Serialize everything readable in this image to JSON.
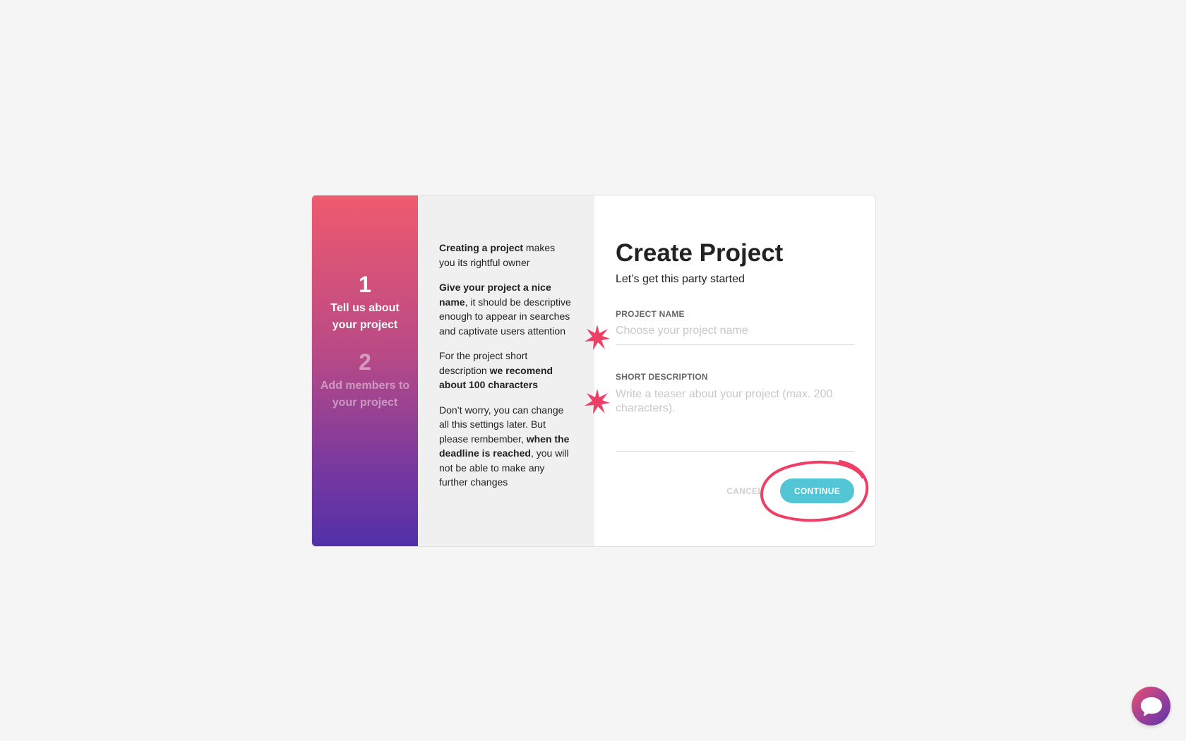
{
  "steps": [
    {
      "number": "1",
      "label": "Tell us about your project"
    },
    {
      "number": "2",
      "label": "Add members to your project"
    }
  ],
  "help": {
    "p1_bold": "Creating a project",
    "p1_rest": " makes you its rightful owner",
    "p2_bold": "Give your project a nice name",
    "p2_rest": ", it should be descriptive enough to appear in searches and captivate users attention",
    "p3_start": "For the project short description ",
    "p3_bold": "we recomend about 100 characters",
    "p4_start": "Don’t worry, you can change all this settings later. But please rembember, ",
    "p4_bold": "when the deadline is reached",
    "p4_rest": ", you will not be able to make any further changes"
  },
  "form": {
    "title": "Create Project",
    "subtitle": "Let’s get this party started",
    "project_name_label": "PROJECT NAME",
    "project_name_placeholder": "Choose your project name",
    "project_name_value": "",
    "short_description_label": "SHORT DESCRIPTION",
    "short_description_placeholder": "Write a teaser about your project (max. 200 characters).",
    "short_description_value": "",
    "cancel_label": "CANCEL",
    "continue_label": "CONTINUE"
  },
  "colors": {
    "accent": "#52c6d4",
    "annotation": "#ee3f66",
    "gradient_top": "#ef5a6e",
    "gradient_bottom": "#5230a8"
  },
  "icons": {
    "chat": "chat-bubble-icon",
    "required_marker": "star-annotation-icon"
  }
}
